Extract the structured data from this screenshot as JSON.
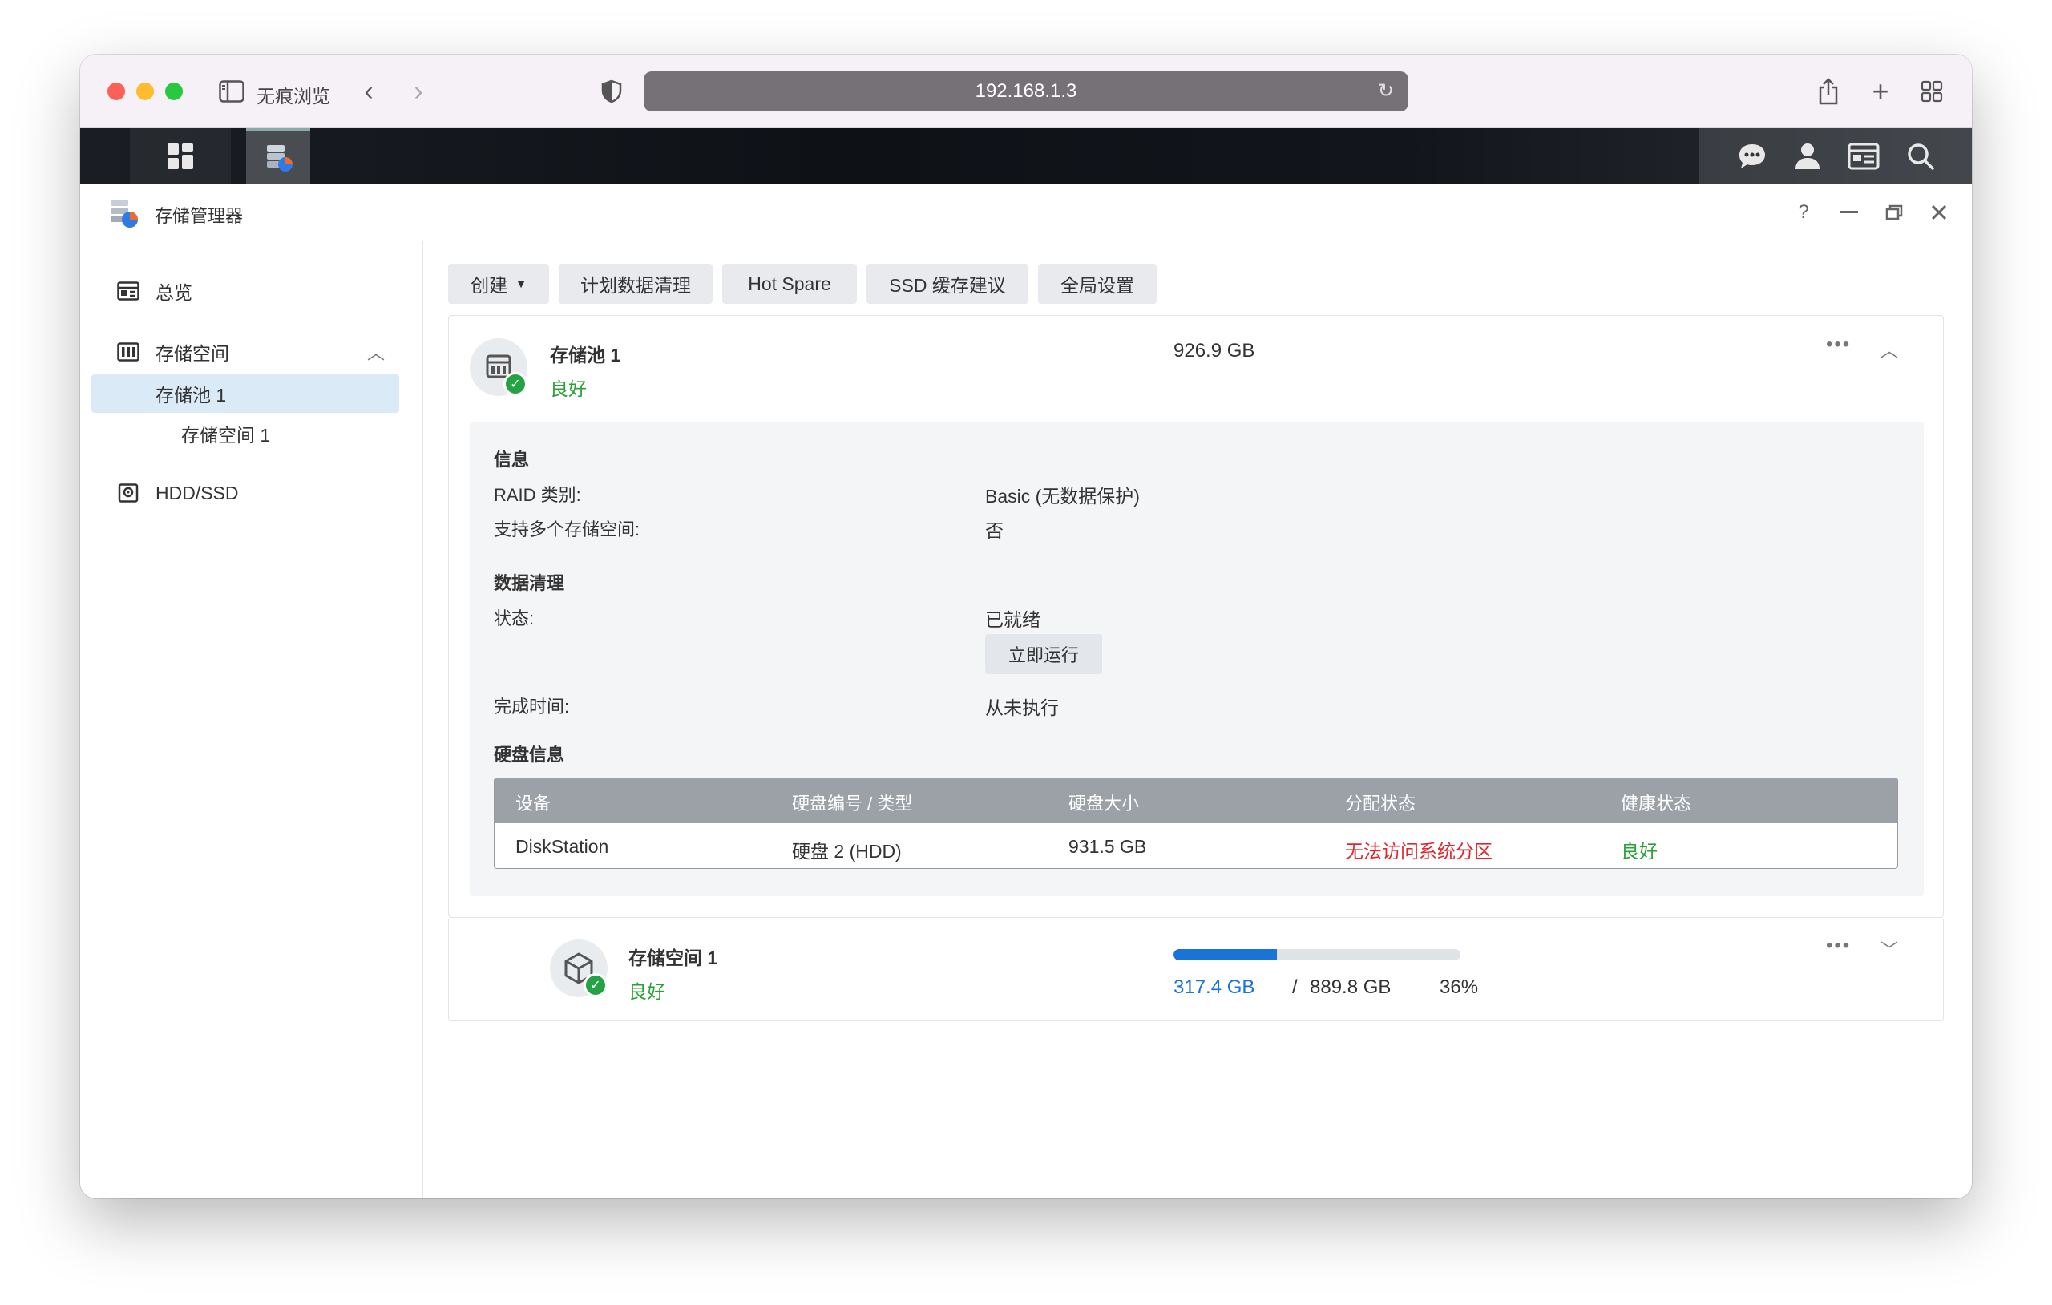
{
  "browser": {
    "private_label": "无痕浏览",
    "url": "192.168.1.3"
  },
  "app": {
    "title": "存储管理器",
    "help_label": "?"
  },
  "sidebar": {
    "items": [
      {
        "label": "总览",
        "icon": "overview-icon"
      },
      {
        "label": "存储空间",
        "icon": "storage-icon"
      },
      {
        "label": "存储池 1"
      },
      {
        "label": "存储空间 1"
      },
      {
        "label": "HDD/SSD",
        "icon": "disk-icon"
      }
    ]
  },
  "toolbar": {
    "create_label": "创建",
    "schedule_label": "计划数据清理",
    "hotspare_label": "Hot Spare",
    "ssd_label": "SSD 缓存建议",
    "global_label": "全局设置"
  },
  "pool": {
    "name": "存储池 1",
    "status": "良好",
    "size": "926.9 GB",
    "info_heading": "信息",
    "raid_label": "RAID 类别:",
    "raid_value": "Basic (无数据保护)",
    "multi_label": "支持多个存储空间:",
    "multi_value": "否",
    "scrub_heading": "数据清理",
    "state_label": "状态:",
    "state_value": "已就绪",
    "run_now_label": "立即运行",
    "done_label": "完成时间:",
    "done_value": "从未执行",
    "disk_heading": "硬盘信息",
    "table": {
      "headers": [
        "设备",
        "硬盘编号 / 类型",
        "硬盘大小",
        "分配状态",
        "健康状态"
      ],
      "rows": [
        [
          "DiskStation",
          "硬盘 2 (HDD)",
          "931.5 GB",
          "无法访问系统分区",
          "良好"
        ]
      ]
    }
  },
  "volume": {
    "name": "存储空间 1",
    "status": "良好",
    "used": "317.4 GB",
    "separator": "/",
    "total": "889.8 GB",
    "percent_label": "36%",
    "usage_fraction": 0.36
  },
  "colors": {
    "good": "#2aa038",
    "error": "#e0262b",
    "accent": "#1a73d6"
  }
}
